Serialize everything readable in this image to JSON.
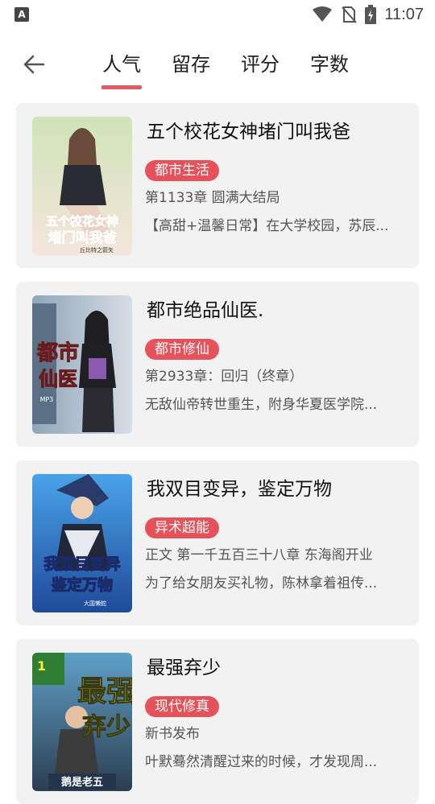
{
  "status_bar": {
    "left_badge": "A",
    "time": "11:07",
    "icons": [
      "wifi-icon",
      "no-sim-icon",
      "battery-charging-icon"
    ]
  },
  "nav": {
    "back_icon": "arrow-left-icon",
    "tabs": [
      {
        "label": "人气",
        "active": true
      },
      {
        "label": "留存",
        "active": false
      },
      {
        "label": "评分",
        "active": false
      },
      {
        "label": "字数",
        "active": false
      }
    ]
  },
  "colors": {
    "accent": "#e6525a",
    "card_bg": "#f2f2f2"
  },
  "books": [
    {
      "title": "五个校花女神堵门叫我爸",
      "tag": "都市生活",
      "chapter": "第1133章 圆满大结局",
      "description": "【高甜+温馨日常】在大学校园，苏辰...",
      "cover_text": "五个校花女神堵门叫我爸",
      "cover_author": "丘比特之箭矢"
    },
    {
      "title": "都市绝品仙医.",
      "tag": "都市修仙",
      "chapter": "第2933章：回归（终章）",
      "description": "无敌仙帝转世重生，附身华夏医学院...",
      "cover_text": "都市绝品仙医",
      "cover_author": "MP3"
    },
    {
      "title": "我双目变异，鉴定万物",
      "tag": "异术超能",
      "chapter": "正文 第一千五百三十八章 东海阁开业",
      "description": "为了给女朋友买礼物，陈林拿着祖传...",
      "cover_text": "我双目变异鉴定万物",
      "cover_author": "大国懒蛇"
    },
    {
      "title": "最强弃少",
      "tag": "现代修真",
      "chapter": "新书发布",
      "description": "叶默蓦然清醒过来的时候，才发现周...",
      "cover_text": "最强弃少",
      "cover_author": "鹅是老五"
    }
  ]
}
